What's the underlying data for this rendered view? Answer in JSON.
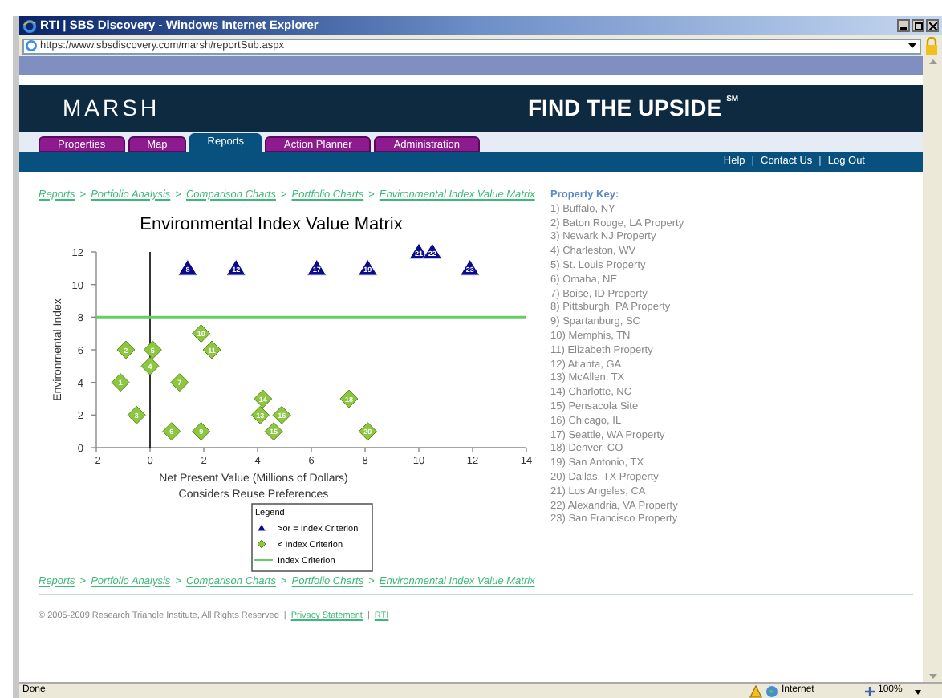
{
  "window": {
    "title": "RTI | SBS Discovery - Windows Internet Explorer",
    "address": "https://www.sbsdiscovery.com/marsh/reportSub.aspx"
  },
  "header": {
    "logo": "MARSH",
    "tagline": "FIND THE UPSIDE",
    "tagline_mark": "SM"
  },
  "tabs": [
    {
      "label": "Properties",
      "selected": false
    },
    {
      "label": "Map",
      "selected": false
    },
    {
      "label": "Reports",
      "selected": true
    },
    {
      "label": "Action Planner",
      "selected": false
    },
    {
      "label": "Administration",
      "selected": false
    }
  ],
  "top_links": [
    {
      "kind": "link",
      "label": "Help"
    },
    {
      "kind": "separator",
      "label": "|"
    },
    {
      "kind": "link",
      "label": "Contact Us"
    },
    {
      "kind": "separator",
      "label": "|"
    },
    {
      "kind": "link",
      "label": "Log Out"
    }
  ],
  "breadcrumb_top": [
    {
      "kind": "link",
      "label": "Reports"
    },
    {
      "kind": "separator",
      "label": ">"
    },
    {
      "kind": "link",
      "label": "Portfolio Analysis"
    },
    {
      "kind": "separator",
      "label": ">"
    },
    {
      "kind": "link",
      "label": "Comparison Charts"
    },
    {
      "kind": "separator",
      "label": ">"
    },
    {
      "kind": "link",
      "label": "Portfolio Charts"
    },
    {
      "kind": "separator",
      "label": ">"
    },
    {
      "kind": "link",
      "label": "Environmental Index Value Matrix"
    }
  ],
  "chart": {
    "xlabel_note": "Considers Reuse Preferences",
    "legend_title": "Legend",
    "chart_data": {
      "type": "scatter",
      "title": "Environmental Index Value Matrix",
      "xlabel": "Net Present Value (Millions of Dollars)",
      "ylabel": "Environmental Index",
      "xlim": [
        -2,
        14
      ],
      "ylim": [
        0,
        12
      ],
      "xticks": [
        -2,
        0,
        2,
        4,
        6,
        8,
        10,
        12,
        14
      ],
      "yticks": [
        0,
        2,
        4,
        6,
        8,
        10,
        12
      ],
      "series": [
        {
          "name": ">or = Index Criterion",
          "color": "#0a0a8c",
          "marker": "triangle",
          "x": [
            1.4,
            3.2,
            6.2,
            8.1,
            10.0,
            10.5,
            11.9
          ],
          "values": [
            11,
            11,
            11,
            11,
            12,
            12,
            11
          ]
        },
        {
          "name": "< Index Criterion",
          "color": "#8dc63f",
          "marker": "diamond",
          "x": [
            -1.1,
            -0.9,
            -0.5,
            0.0,
            0.1,
            0.8,
            1.1,
            1.9,
            1.9,
            2.3,
            4.1,
            4.2,
            4.6,
            4.9,
            7.4,
            8.1
          ],
          "values": [
            4,
            6,
            2,
            5,
            6,
            1,
            4,
            1,
            7,
            6,
            2,
            3,
            1,
            2,
            3,
            1
          ]
        }
      ],
      "annotations": [
        {
          "x": 1.4,
          "y": 11,
          "text": "8"
        },
        {
          "x": 3.2,
          "y": 11,
          "text": "12"
        },
        {
          "x": 6.2,
          "y": 11,
          "text": "17"
        },
        {
          "x": 8.1,
          "y": 11,
          "text": "19"
        },
        {
          "x": 10.0,
          "y": 12,
          "text": "21"
        },
        {
          "x": 10.5,
          "y": 12,
          "text": "22"
        },
        {
          "x": 11.9,
          "y": 11,
          "text": "23"
        },
        {
          "x": -1.1,
          "y": 4,
          "text": "1"
        },
        {
          "x": -0.9,
          "y": 6,
          "text": "2"
        },
        {
          "x": -0.5,
          "y": 2,
          "text": "3"
        },
        {
          "x": 0.0,
          "y": 5,
          "text": "4"
        },
        {
          "x": 0.1,
          "y": 6,
          "text": "5"
        },
        {
          "x": 0.8,
          "y": 1,
          "text": "6"
        },
        {
          "x": 1.1,
          "y": 4,
          "text": "7"
        },
        {
          "x": 1.9,
          "y": 1,
          "text": "9"
        },
        {
          "x": 1.9,
          "y": 7,
          "text": "10"
        },
        {
          "x": 2.3,
          "y": 6,
          "text": "11"
        },
        {
          "x": 4.1,
          "y": 2,
          "text": "13"
        },
        {
          "x": 4.2,
          "y": 3,
          "text": "14"
        },
        {
          "x": 4.6,
          "y": 1,
          "text": "15"
        },
        {
          "x": 4.9,
          "y": 2,
          "text": "16"
        },
        {
          "x": 7.4,
          "y": 3,
          "text": "18"
        },
        {
          "x": 8.1,
          "y": 1,
          "text": "20"
        }
      ],
      "ref_lines": [
        {
          "axis": "y",
          "value": 8,
          "label": "Index Criterion",
          "color": "#66cc66"
        }
      ],
      "legend": "bottom"
    }
  },
  "property_key": {
    "title": "Property Key:",
    "items": [
      "1) Buffalo, NY",
      "2) Baton Rouge, LA Property",
      "3) Newark NJ Property",
      "4) Charleston, WV",
      "5) St. Louis Property",
      "6) Omaha, NE",
      "7) Boise, ID Property",
      "8) Pittsburgh, PA Property",
      "9) Spartanburg, SC",
      "10) Memphis, TN",
      "11) Elizabeth Property",
      "12) Atlanta, GA",
      "13) McAllen, TX",
      "14) Charlotte, NC",
      "15) Pensacola Site",
      "16) Chicago, IL",
      "17) Seattle, WA Property",
      "18) Denver, CO",
      "19) San Antonio, TX",
      "20) Dallas, TX Property",
      "21) Los Angeles, CA",
      "22) Alexandria, VA Property",
      "23) San Francisco Property"
    ]
  },
  "breadcrumb_bottom": [
    {
      "kind": "link",
      "label": "Reports"
    },
    {
      "kind": "separator",
      "label": ">"
    },
    {
      "kind": "link",
      "label": "Portfolio Analysis"
    },
    {
      "kind": "separator",
      "label": ">"
    },
    {
      "kind": "link",
      "label": "Comparison Charts"
    },
    {
      "kind": "separator",
      "label": ">"
    },
    {
      "kind": "link",
      "label": "Portfolio Charts"
    },
    {
      "kind": "separator",
      "label": ">"
    },
    {
      "kind": "link",
      "label": "Environmental Index Value Matrix"
    }
  ],
  "footer": [
    {
      "kind": "text",
      "label": "© 2005-2009 Research Triangle Institute, All Rights Reserved"
    },
    {
      "kind": "separator",
      "label": "|"
    },
    {
      "kind": "link",
      "label": "Privacy Statement"
    },
    {
      "kind": "separator",
      "label": "|"
    },
    {
      "kind": "link",
      "label": "RTI"
    }
  ],
  "status_bar": {
    "status": "Done",
    "zone": "Internet",
    "zoom": "100%"
  }
}
